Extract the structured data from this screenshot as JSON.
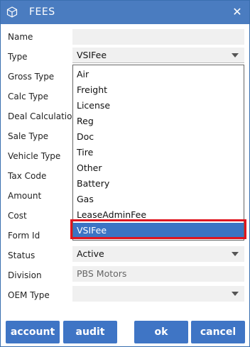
{
  "window": {
    "title": "FEES",
    "title_icon": "cube-icon",
    "close_icon": "close-icon",
    "accent": "#4a7cc0"
  },
  "form": {
    "fields": [
      {
        "label": "Name",
        "value": ""
      },
      {
        "label": "Type",
        "value": "VSIFee"
      },
      {
        "label": "Gross Type",
        "value": ""
      },
      {
        "label": "Calc Type",
        "value": ""
      },
      {
        "label": "Deal Calculation",
        "value": ""
      },
      {
        "label": "Sale Type",
        "value": ""
      },
      {
        "label": "Vehicle Type",
        "value": ""
      },
      {
        "label": "Tax Code",
        "value": ""
      },
      {
        "label": "Amount",
        "value": ""
      },
      {
        "label": "Cost",
        "value": ""
      },
      {
        "label": "Form Id",
        "value": ""
      },
      {
        "label": "Status",
        "value": "Active"
      },
      {
        "label": "Division",
        "value": "PBS Motors"
      },
      {
        "label": "OEM Type",
        "value": ""
      }
    ]
  },
  "type_dropdown": {
    "options": [
      "Air",
      "Freight",
      "License",
      "Reg",
      "Doc",
      "Tire",
      "Other",
      "Battery",
      "Gas",
      "LeaseAdminFee",
      "VSIFee"
    ],
    "selected": "VSIFee",
    "highlight_color": "#e0151f",
    "selected_color": "#3c74c4"
  },
  "buttons": {
    "account": "account",
    "audit": "audit",
    "ok": "ok",
    "cancel": "cancel",
    "color": "#3f75c5"
  }
}
